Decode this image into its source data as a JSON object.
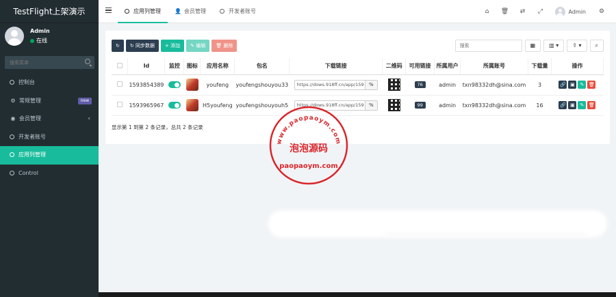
{
  "sidebar": {
    "brand": "TestFlight上架演示",
    "user_name": "Admin",
    "user_status": "在线",
    "search_placeholder": "搜索菜单",
    "items": [
      {
        "label": "控制台",
        "icon": "circle-icon",
        "active": false
      },
      {
        "label": "常规管理",
        "icon": "gears-icon",
        "badge": "new",
        "active": false
      },
      {
        "label": "会员管理",
        "icon": "user-circle-icon",
        "active": false
      },
      {
        "label": "开发者账号",
        "icon": "circle-icon",
        "active": false
      },
      {
        "label": "应用列管理",
        "icon": "circle-icon",
        "active": true
      },
      {
        "label": "Control",
        "icon": "circle-icon",
        "active": false
      }
    ]
  },
  "topbar": {
    "tabs": [
      {
        "label": "应用列管理",
        "icon": "circle-icon",
        "active": true
      },
      {
        "label": "会员管理",
        "icon": "user-icon",
        "active": false
      },
      {
        "label": "开发者账号",
        "icon": "circle-icon",
        "active": false
      }
    ],
    "user_name": "Admin"
  },
  "toolbar": {
    "sync_label": "同步数据",
    "add_label": "添加",
    "edit_label": "编辑",
    "delete_label": "删除",
    "search_placeholder": "搜索"
  },
  "table": {
    "headers": [
      "Id",
      "监控",
      "图标",
      "应用名称",
      "包名",
      "下载链接",
      "二维码",
      "可用链接",
      "所属用户",
      "所属账号",
      "下载量",
      "操作"
    ],
    "rows": [
      {
        "id": "1593854389",
        "name": "youfeng",
        "package": "youfengshouyou33",
        "link": "https://dows.918ff.cn/app/159",
        "available": "76",
        "user": "admin",
        "account": "txn98332dh@sina.com",
        "downloads": "3"
      },
      {
        "id": "1593965967",
        "name": "H5youfeng",
        "package": "youfengshouyouh5",
        "link": "https://dows.918ff.cn/app/159",
        "available": "99",
        "user": "admin",
        "account": "txn98332dh@sina.com",
        "downloads": "16"
      }
    ],
    "summary": "显示第 1 到第 2 条记录，总共 2 条记录"
  },
  "watermark": {
    "top": "www.paopaoym.com",
    "middle": "泡泡源码",
    "bottom": "paopaoym.com"
  },
  "colors": {
    "sidebar_bg": "#222d32",
    "accent": "#18bc9c",
    "dark_btn": "#2c3e50",
    "danger": "#e74c3c",
    "stamp": "#d9262b"
  }
}
